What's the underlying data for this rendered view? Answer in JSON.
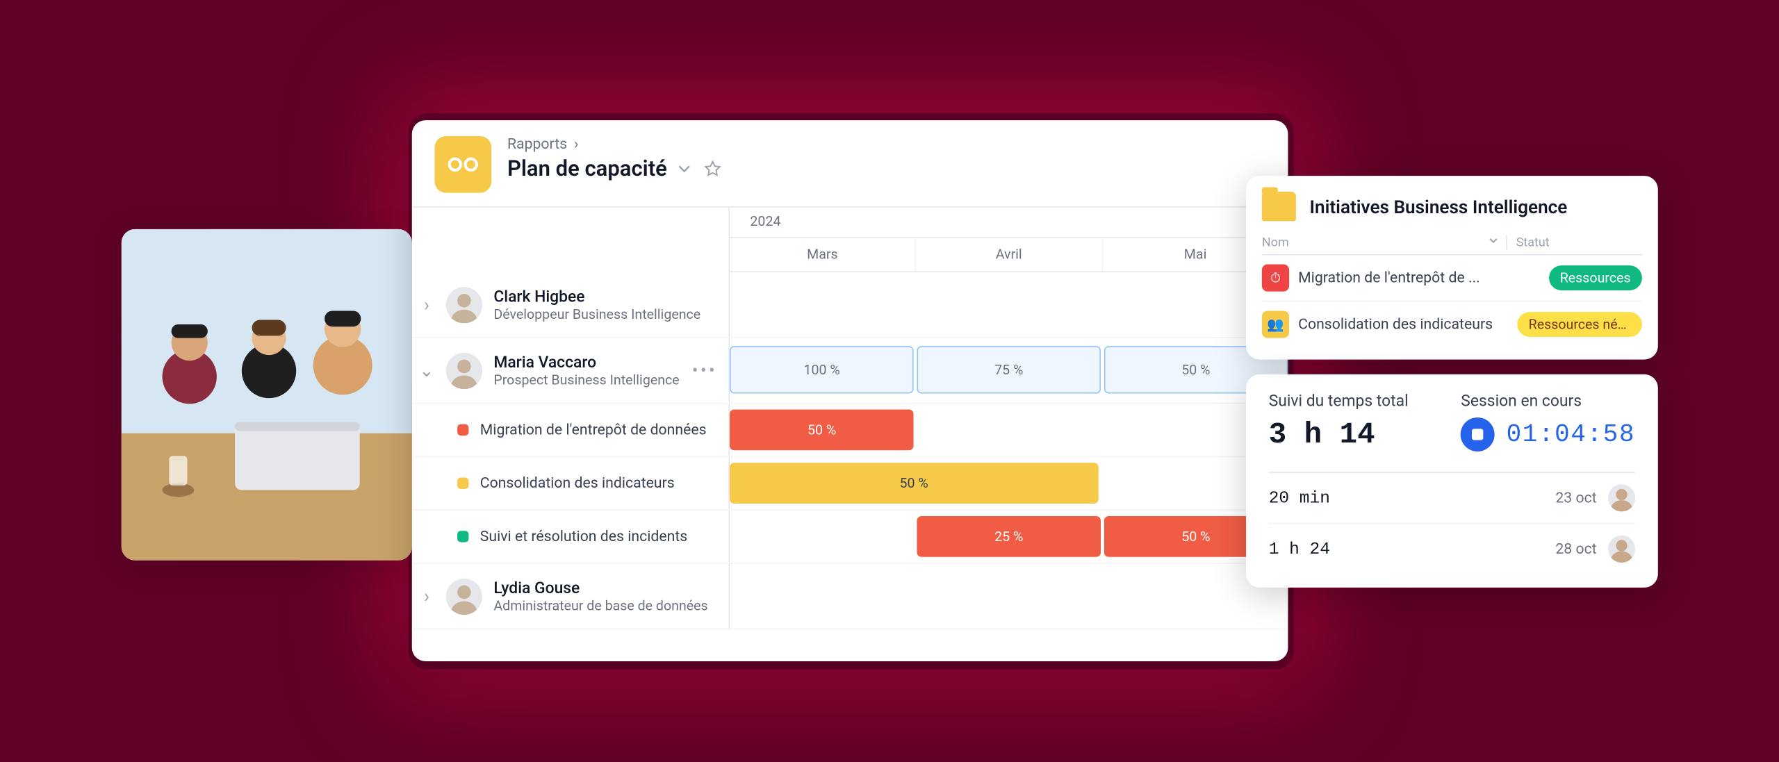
{
  "photo_alt": "Trois collègues regardant un ordinateur portable",
  "breadcrumb": "Rapports",
  "page_title": "Plan de capacité",
  "timeline": {
    "year": "2024",
    "months": [
      "Mars",
      "Avril",
      "Mai"
    ]
  },
  "people": [
    {
      "name": "Clark Higbee",
      "role": "Développeur Business Intelligence",
      "expanded": false,
      "allocations": [],
      "tasks": []
    },
    {
      "name": "Maria Vaccaro",
      "role": "Prospect Business Intelligence",
      "expanded": true,
      "allocations": [
        {
          "label": "100 %",
          "left_pct": 0,
          "width_pct": 33
        },
        {
          "label": "75 %",
          "left_pct": 33.5,
          "width_pct": 33
        },
        {
          "label": "50 %",
          "left_pct": 67,
          "width_pct": 33
        }
      ],
      "tasks": [
        {
          "dot": "#f05d44",
          "name": "Migration de l'entrepôt de données",
          "bars": [
            {
              "cls": "red-bar",
              "label": "50 %",
              "left_pct": 0,
              "width_pct": 33
            }
          ]
        },
        {
          "dot": "#f7c948",
          "name": "Consolidation des indicateurs",
          "bars": [
            {
              "cls": "yellow-bar",
              "label": "50 %",
              "left_pct": 0,
              "width_pct": 66
            }
          ]
        },
        {
          "dot": "#10b981",
          "name": "Suivi et résolution des incidents",
          "bars": [
            {
              "cls": "red-bar",
              "label": "25 %",
              "left_pct": 33.5,
              "width_pct": 33
            },
            {
              "cls": "red-bar",
              "label": "50 %",
              "left_pct": 67,
              "width_pct": 33
            }
          ]
        }
      ]
    },
    {
      "name": "Lydia Gouse",
      "role": "Administrateur de base de données",
      "expanded": false,
      "allocations": [],
      "tasks": []
    }
  ],
  "initiatives": {
    "title": "Initiatives Business Intelligence",
    "columns": {
      "name": "Nom",
      "status": "Statut"
    },
    "rows": [
      {
        "icon_cls": "tr-red",
        "icon_glyph": "⏱",
        "name": "Migration de l'entrepôt de ...",
        "badge_cls": "badge-green",
        "badge": "Ressources"
      },
      {
        "icon_cls": "tr-yellow",
        "icon_glyph": "👥",
        "name": "Consolidation des indicateurs",
        "badge_cls": "badge-yellow",
        "badge": "Ressources néce..."
      }
    ]
  },
  "time_tracking": {
    "total_label": "Suivi du temps total",
    "total_value": "3 h 14",
    "session_label": "Session en cours",
    "session_value": "01:04:58",
    "entries": [
      {
        "duration": "20 min",
        "date": "23 oct"
      },
      {
        "duration": "1 h 24",
        "date": "28 oct"
      }
    ]
  }
}
